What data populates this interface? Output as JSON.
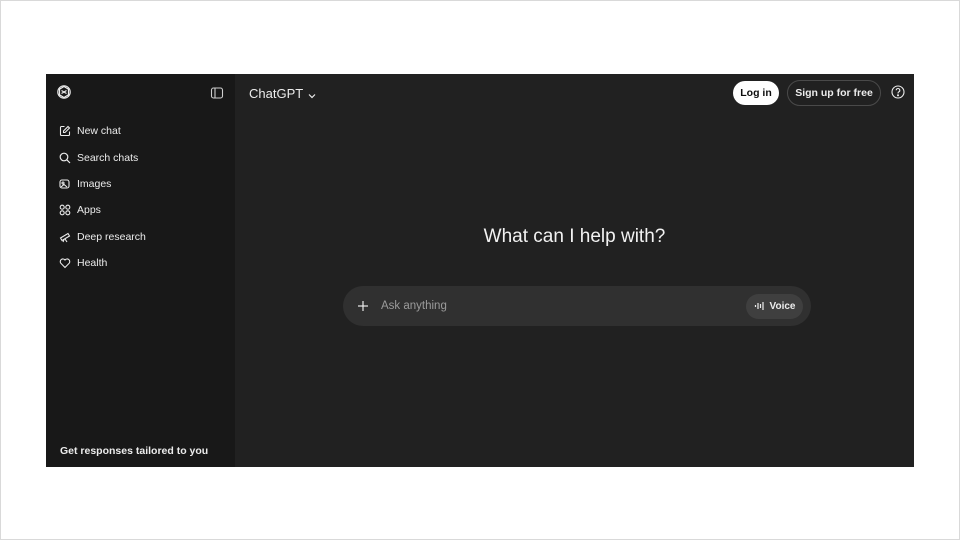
{
  "sidebar": {
    "items": [
      {
        "label": "New chat",
        "icon": "edit-icon"
      },
      {
        "label": "Search chats",
        "icon": "search-icon"
      },
      {
        "label": "Images",
        "icon": "images-icon"
      },
      {
        "label": "Apps",
        "icon": "apps-icon"
      },
      {
        "label": "Deep research",
        "icon": "telescope-icon"
      },
      {
        "label": "Health",
        "icon": "heart-icon"
      }
    ],
    "footer_text": "Get responses tailored to you"
  },
  "header": {
    "model_label": "ChatGPT",
    "login_label": "Log in",
    "signup_label": "Sign up for free"
  },
  "main": {
    "headline": "What can I help with?",
    "composer_placeholder": "Ask anything",
    "voice_label": "Voice"
  },
  "colors": {
    "background": "#212121",
    "sidebar": "#181818",
    "composer": "#303030",
    "text": "#ececec"
  }
}
